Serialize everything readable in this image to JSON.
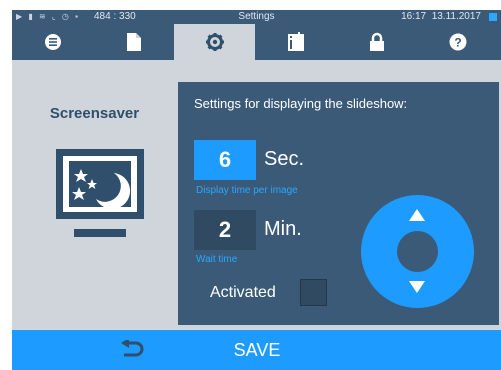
{
  "status_bar": {
    "coordinates": "484 : 330",
    "title": "Settings",
    "time": "16:17",
    "date": "13.11.2017"
  },
  "tabs": [
    {
      "icon": "menu-list-icon"
    },
    {
      "icon": "document-icon"
    },
    {
      "icon": "gear-icon",
      "active": true
    },
    {
      "icon": "info-book-icon"
    },
    {
      "icon": "lock-icon"
    },
    {
      "icon": "help-icon"
    }
  ],
  "left": {
    "title": "Screensaver",
    "icon": "screensaver-monitor-icon"
  },
  "panel": {
    "heading": "Settings for displaying the slideshow:",
    "display_time": {
      "value": "6",
      "unit": "Sec.",
      "label": "Display time per image"
    },
    "wait_time": {
      "value": "2",
      "unit": "Min.",
      "label": "Wait time"
    },
    "activated_label": "Activated",
    "activated": false
  },
  "bottom": {
    "back_icon": "back-arrow-icon",
    "save_label": "SAVE"
  },
  "colors": {
    "header": "#3a5a78",
    "accent": "#1e9bff",
    "background": "#cfd5db",
    "panel": "#3a5a78"
  }
}
